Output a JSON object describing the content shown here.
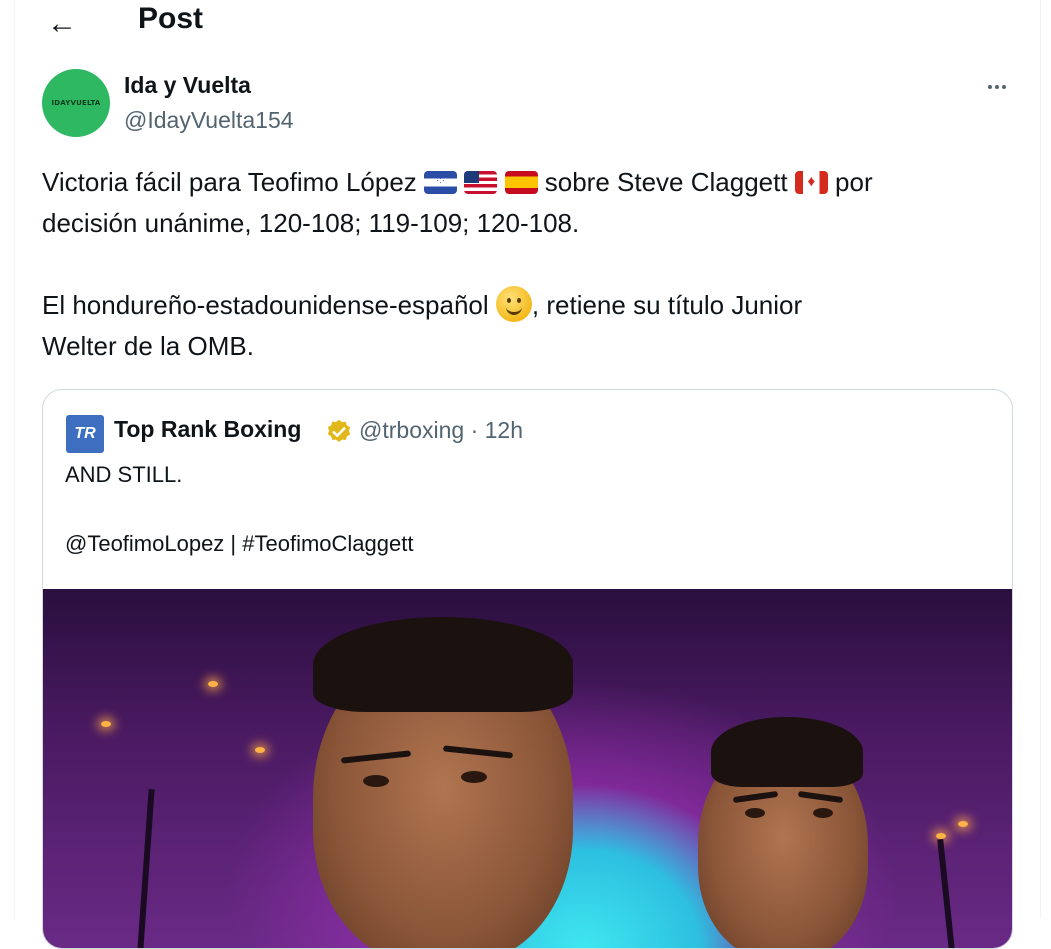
{
  "header": {
    "title": "Post",
    "back_icon": "arrow-left-icon"
  },
  "author": {
    "display_name": "Ida y Vuelta",
    "handle": "@IdayVuelta154",
    "avatar_color": "#2eb862",
    "avatar_text": "IDAYVUELTA"
  },
  "tweet": {
    "line1_a": "Victoria fácil para Teofimo López",
    "line1_b": "sobre Steve Claggett",
    "line1_c": "por",
    "line2": "decisión unánime, 120-108; 119-109; 120-108.",
    "para2_a": "El hondureño-estadounidense-español",
    "para2_b": ", retiene su título Junior",
    "para2_c": "Welter de la OMB."
  },
  "quote": {
    "logo_text": "TR",
    "name": "Top Rank Boxing",
    "meta": "@trboxing · 12h",
    "line1": "AND STILL.",
    "line2": "@TeofimoLopez | #TeofimoClaggett",
    "verified_color": "#e2b719"
  },
  "colors": {
    "text": "#0f1419",
    "secondary": "#536471",
    "border": "#cfd9de"
  }
}
